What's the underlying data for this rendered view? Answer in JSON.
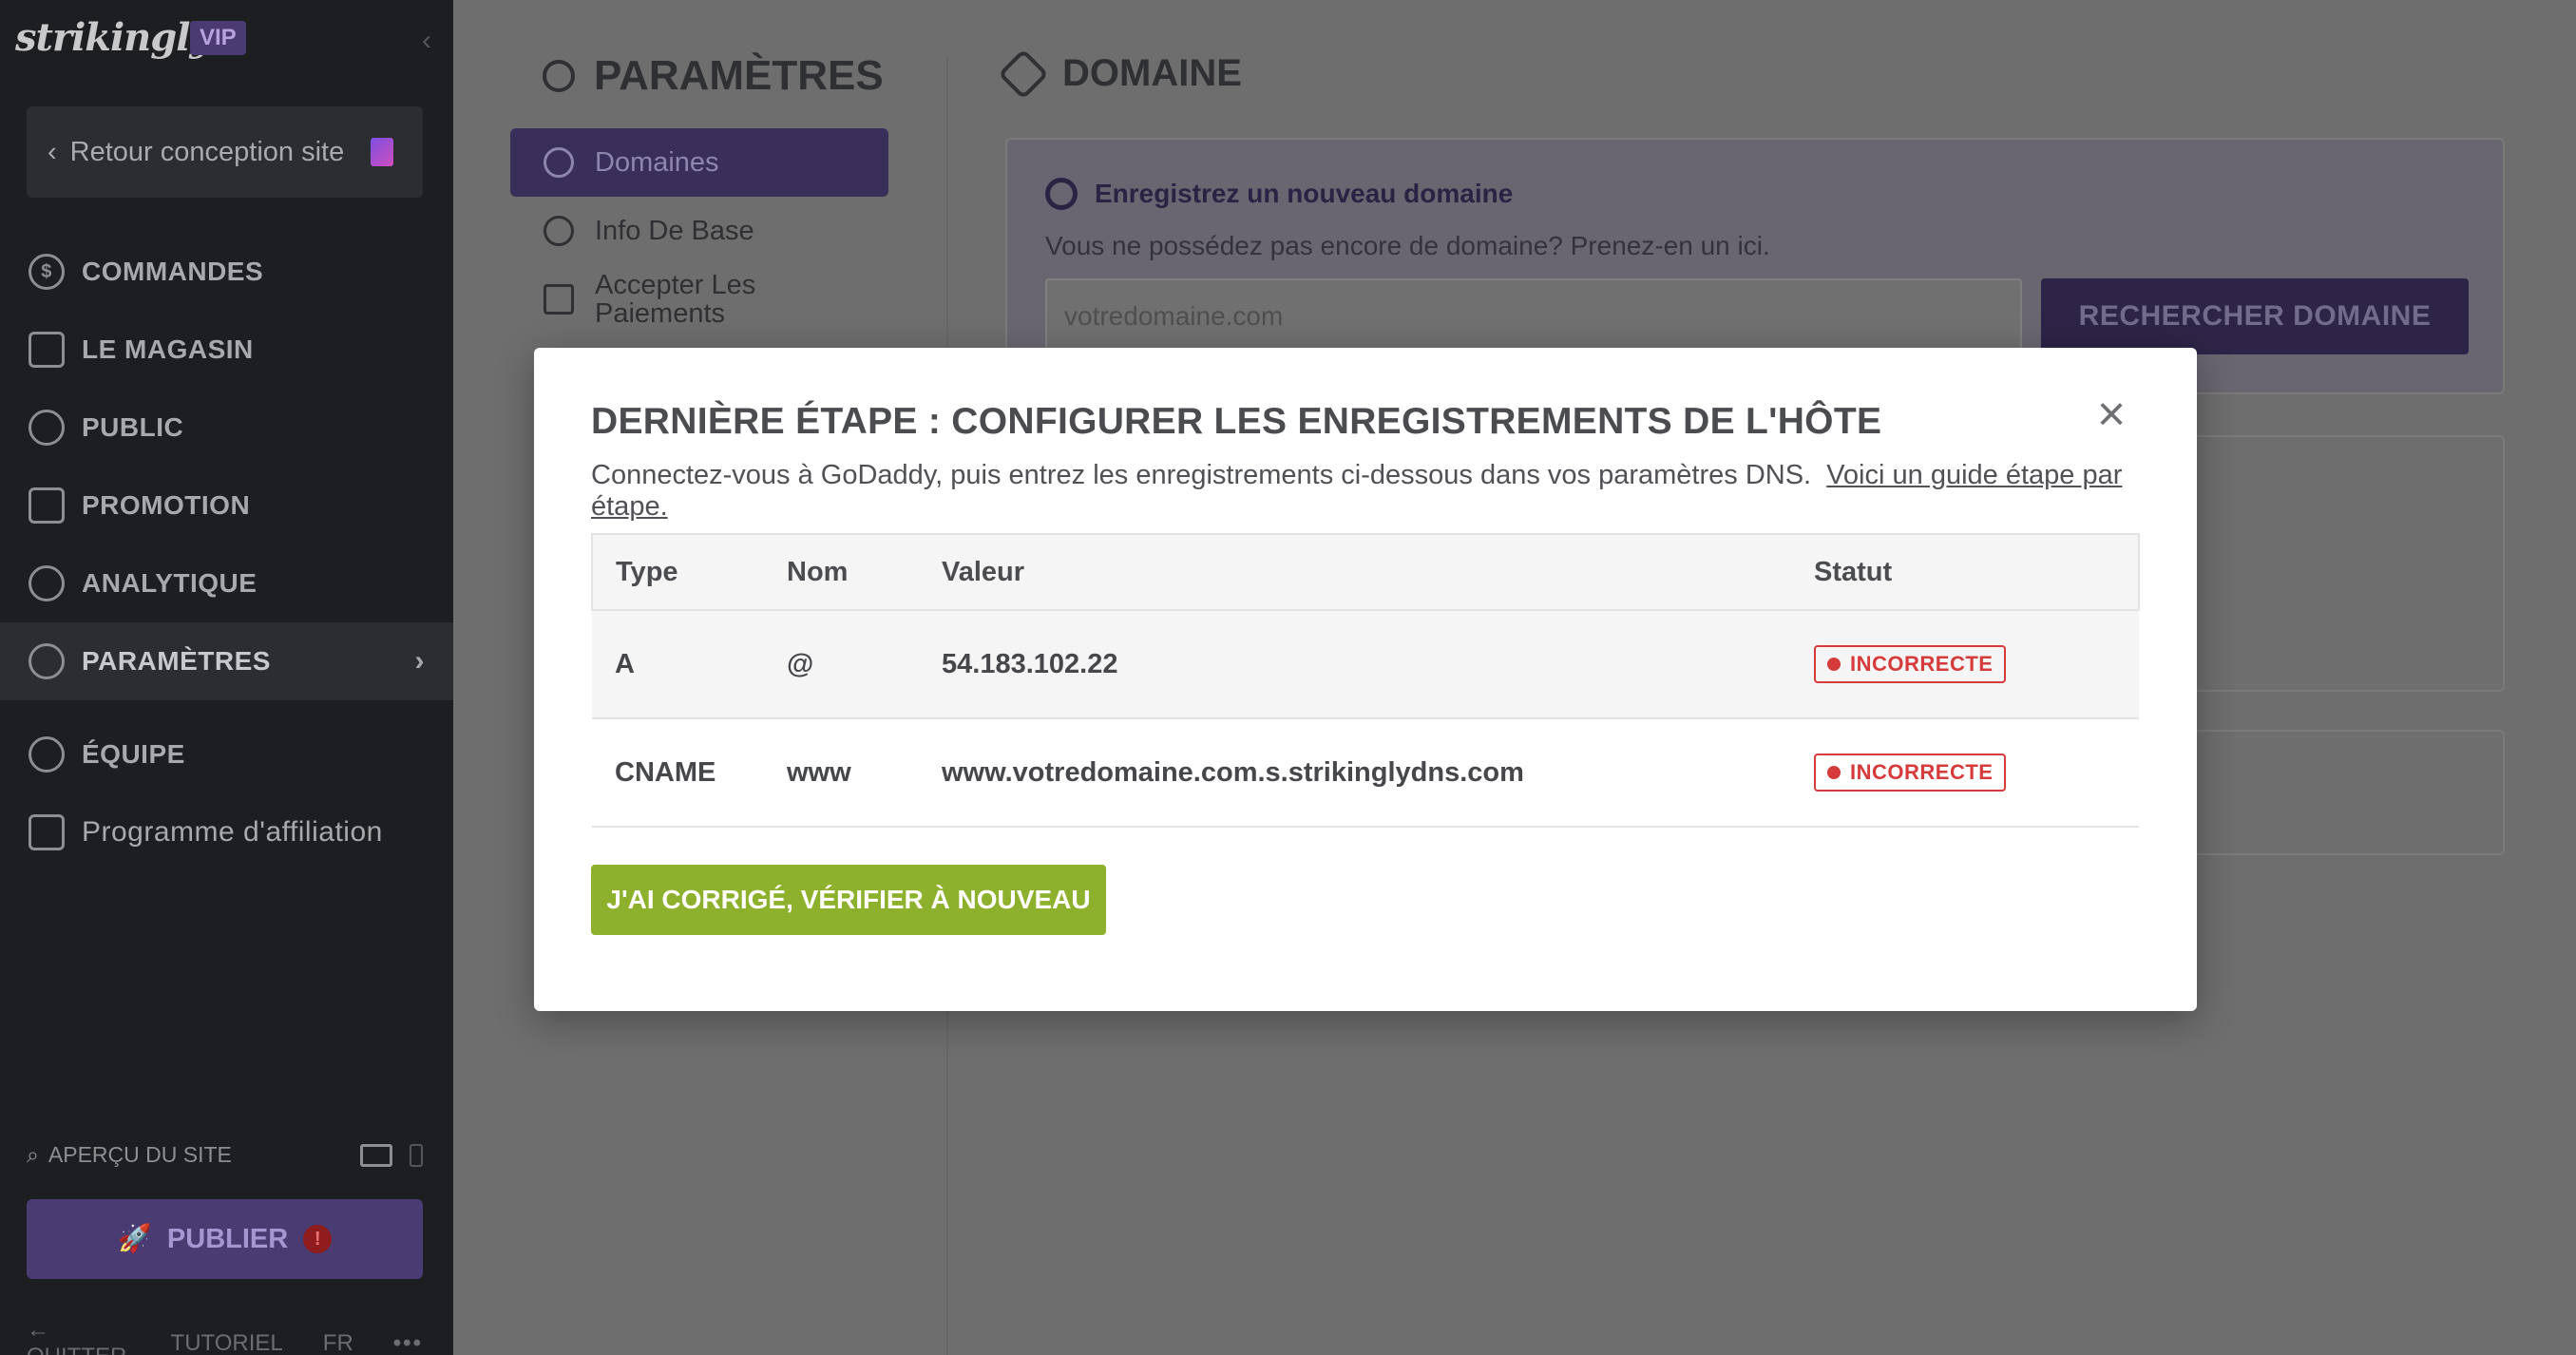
{
  "sidebar": {
    "logo": "strikingly",
    "vip": "VIP",
    "back_label": "Retour conception site",
    "nav": [
      {
        "label": "COMMANDES",
        "icon": "dollar-icon"
      },
      {
        "label": "LE MAGASIN",
        "icon": "store-icon"
      },
      {
        "label": "PUBLIC",
        "icon": "people-icon"
      },
      {
        "label": "PROMOTION",
        "icon": "megaphone-icon"
      },
      {
        "label": "ANALYTIQUE",
        "icon": "pie-icon"
      },
      {
        "label": "PARAMÈTRES",
        "icon": "gear-icon"
      },
      {
        "label": "ÉQUIPE",
        "icon": "team-icon"
      },
      {
        "label": "Programme d'affiliation",
        "icon": "trophy-icon"
      }
    ],
    "preview_label": "APERÇU DU SITE",
    "publish_label": "PUBLIER",
    "publish_warning": "!",
    "footer": {
      "quit": "QUITTER",
      "tutorial": "TUTORIEL",
      "lang": "FR",
      "more": "•••"
    }
  },
  "settings": {
    "title": "PARAMÈTRES",
    "items": [
      {
        "label": "Domaines"
      },
      {
        "label": "Info De Base"
      },
      {
        "label": "Accepter Les Paiements"
      }
    ]
  },
  "domain": {
    "title": "DOMAINE",
    "register_heading": "Enregistrez un nouveau domaine",
    "register_sub": "Vous ne possédez pas encore de domaine? Prenez-en un ici.",
    "input_placeholder": "votredomaine.com",
    "search_button": "RECHERCHER DOMAINE"
  },
  "modal": {
    "title": "DERNIÈRE ÉTAPE : CONFIGURER LES ENREGISTREMENTS DE L'HÔTE",
    "description": "Connectez-vous à GoDaddy, puis entrez les enregistrements ci-dessous dans vos paramètres DNS.",
    "guide_link": "Voici un guide étape par étape.",
    "close": "×",
    "columns": {
      "type": "Type",
      "nom": "Nom",
      "valeur": "Valeur",
      "statut": "Statut"
    },
    "rows": [
      {
        "type": "A",
        "nom": "@",
        "valeur": "54.183.102.22",
        "statut": "INCORRECTE"
      },
      {
        "type": "CNAME",
        "nom": "www",
        "valeur": "www.votredomaine.com.s.strikinglydns.com",
        "statut": "INCORRECTE"
      }
    ],
    "verify_button": "J'AI CORRIGÉ, VÉRIFIER À NOUVEAU"
  },
  "colors": {
    "accent_purple": "#6b52b3",
    "verify_green": "#8db12c",
    "status_red": "#d63b3b",
    "sidebar_bg": "#1d1e21"
  }
}
